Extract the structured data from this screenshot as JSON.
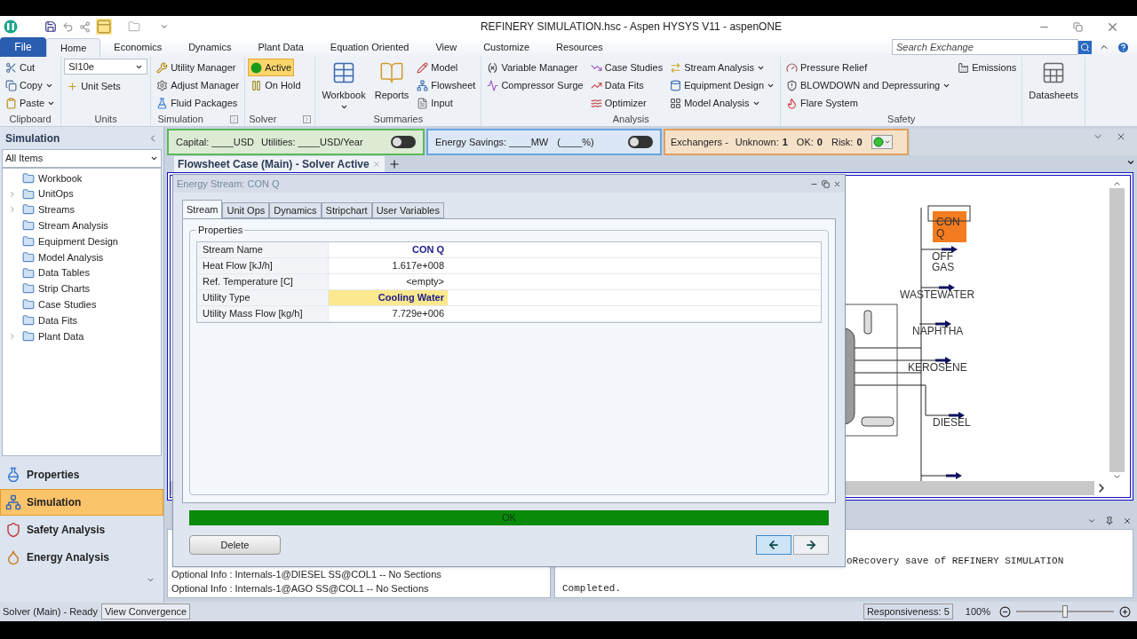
{
  "window": {
    "title": "REFINERY SIMULATION.hsc - Aspen HYSYS V11 - aspenONE"
  },
  "ribbon_tabs": [
    {
      "label": "File",
      "kind": "file",
      "selected": false
    },
    {
      "label": "Home",
      "kind": "tab",
      "selected": true
    },
    {
      "label": "Economics",
      "kind": "tab",
      "selected": false
    },
    {
      "label": "Dynamics",
      "kind": "tab",
      "selected": false
    },
    {
      "label": "Plant Data",
      "kind": "tab",
      "selected": false
    },
    {
      "label": "Equation Oriented",
      "kind": "tab",
      "selected": false
    },
    {
      "label": "View",
      "kind": "tab",
      "selected": false
    },
    {
      "label": "Customize",
      "kind": "tab",
      "selected": false
    },
    {
      "label": "Resources",
      "kind": "tab",
      "selected": false
    }
  ],
  "search": {
    "placeholder": "Search Exchange"
  },
  "ribbon_groups": [
    {
      "label": "Clipboard",
      "launcher": false,
      "columns": [
        [
          {
            "kind": "small",
            "label": "Cut",
            "menu": false
          },
          {
            "kind": "small",
            "label": "Copy",
            "menu": true
          },
          {
            "kind": "small",
            "label": "Paste",
            "menu": true
          }
        ]
      ]
    },
    {
      "label": "Units",
      "launcher": false,
      "columns": [
        [
          {
            "kind": "select",
            "label": "SI10e",
            "menu": true
          },
          {
            "kind": "small",
            "label": "Unit Sets",
            "menu": false
          }
        ]
      ]
    },
    {
      "label": "Simulation",
      "launcher": true,
      "columns": [
        [
          {
            "kind": "small",
            "label": "Utility Manager",
            "menu": false
          },
          {
            "kind": "small",
            "label": "Adjust Manager",
            "menu": false
          },
          {
            "kind": "small",
            "label": "Fluid Packages",
            "menu": false
          }
        ]
      ]
    },
    {
      "label": "Solver",
      "launcher": true,
      "columns": [
        [
          {
            "kind": "toggle",
            "label": "Active",
            "selected": true
          },
          {
            "kind": "toggle",
            "label": "On Hold",
            "selected": false
          }
        ]
      ]
    },
    {
      "label": "Summaries",
      "launcher": false,
      "columns": [
        [
          {
            "kind": "large",
            "label": "Workbook",
            "menu": true
          }
        ],
        [
          {
            "kind": "large",
            "label": "Reports",
            "menu": false
          }
        ],
        [
          {
            "kind": "small",
            "label": "Model",
            "menu": false
          },
          {
            "kind": "small",
            "label": "Flowsheet",
            "menu": false
          },
          {
            "kind": "small",
            "label": "Input",
            "menu": false
          }
        ]
      ]
    },
    {
      "label": "Analysis",
      "launcher": false,
      "columns": [
        [
          {
            "kind": "small",
            "label": "Variable Manager",
            "menu": false
          },
          {
            "kind": "small",
            "label": "Compressor Surge",
            "menu": false
          }
        ],
        [
          {
            "kind": "small",
            "label": "Case Studies",
            "menu": false
          },
          {
            "kind": "small",
            "label": "Data Fits",
            "menu": false
          },
          {
            "kind": "small",
            "label": "Optimizer",
            "menu": false
          }
        ],
        [
          {
            "kind": "small",
            "label": "Stream Analysis",
            "menu": true
          },
          {
            "kind": "small",
            "label": "Equipment Design",
            "menu": true
          },
          {
            "kind": "small",
            "label": "Model Analysis",
            "menu": true
          }
        ]
      ]
    },
    {
      "label": "Safety",
      "launcher": false,
      "columns": [
        [
          {
            "kind": "small",
            "label": "Pressure Relief",
            "menu": false
          },
          {
            "kind": "small",
            "label": "BLOWDOWN and Depressuring",
            "menu": true
          },
          {
            "kind": "small",
            "label": "Flare System",
            "menu": false
          }
        ],
        [
          {
            "kind": "small",
            "label": "Emissions",
            "menu": false
          }
        ]
      ]
    },
    {
      "columns": [
        [
          {
            "kind": "large",
            "label": "Datasheets",
            "menu": false
          }
        ]
      ]
    }
  ],
  "sidebar": {
    "title": "Simulation",
    "filter": "All Items",
    "items": [
      {
        "label": "Workbook",
        "expandable": false
      },
      {
        "label": "UnitOps",
        "expandable": true
      },
      {
        "label": "Streams",
        "expandable": true
      },
      {
        "label": "Stream Analysis",
        "expandable": false
      },
      {
        "label": "Equipment Design",
        "expandable": false
      },
      {
        "label": "Model Analysis",
        "expandable": false
      },
      {
        "label": "Data Tables",
        "expandable": false
      },
      {
        "label": "Strip Charts",
        "expandable": false
      },
      {
        "label": "Case Studies",
        "expandable": false
      },
      {
        "label": "Data Fits",
        "expandable": false
      },
      {
        "label": "Plant Data",
        "expandable": true
      }
    ],
    "nav": [
      {
        "label": "Properties",
        "selected": false
      },
      {
        "label": "Simulation",
        "selected": true
      },
      {
        "label": "Safety Analysis",
        "selected": false
      },
      {
        "label": "Energy Analysis",
        "selected": false
      }
    ]
  },
  "energy_bar": {
    "capital": {
      "capital": "Capital: ____USD",
      "utilities": "Utilities: ____USD/Year",
      "on": false
    },
    "savings": {
      "text": "Energy Savings: ____MW",
      "percent": "(____%)",
      "on": false
    },
    "exchangers": {
      "label": "Exchangers -",
      "counts": [
        {
          "label": "Unknown:",
          "value": "1"
        },
        {
          "label": "OK:",
          "value": "0"
        },
        {
          "label": "Risk:",
          "value": "0"
        }
      ]
    }
  },
  "doc_tabs": [
    {
      "label": "Flowsheet Case (Main) - Solver Active",
      "selected": true
    }
  ],
  "flowsheet": {
    "streams": [
      {
        "kind": "energy",
        "label": "CON Q"
      },
      {
        "kind": "material",
        "label": "OFF GAS"
      },
      {
        "kind": "material",
        "label": "WASTEWATER"
      },
      {
        "kind": "material",
        "label": "NAPHTHA"
      },
      {
        "kind": "material",
        "label": "KEROSENE"
      },
      {
        "kind": "material",
        "label": "DIESEL"
      }
    ]
  },
  "dialog": {
    "title": "Energy Stream: CON Q",
    "tabs": [
      {
        "label": "Stream",
        "selected": true
      },
      {
        "label": "Unit Ops",
        "selected": false
      },
      {
        "label": "Dynamics",
        "selected": false
      },
      {
        "label": "Stripchart",
        "selected": false
      },
      {
        "label": "User Variables",
        "selected": false
      }
    ],
    "group": "Properties",
    "rows": [
      {
        "label": "Stream Name",
        "value": "CON Q",
        "kind": "name"
      },
      {
        "label": "Heat Flow [kJ/h]",
        "value": "1.617e+008",
        "kind": "number"
      },
      {
        "label": "Ref. Temperature [C]",
        "value": "<empty>",
        "kind": "number"
      },
      {
        "label": "Utility Type",
        "value": "Cooling Water",
        "kind": "selection"
      },
      {
        "label": "Utility Mass Flow [kg/h]",
        "value": "7.729e+006",
        "kind": "number"
      }
    ],
    "status": "OK",
    "delete": "Delete"
  },
  "messages": {
    "left": [
      "Optional Info : Internals-1@DIESEL SS@COL1 -- No Sections",
      "Optional Info : Internals-1@AGO SS@COL1 -- No Sections"
    ],
    "right": [
      "oRecovery save of REFINERY SIMULATION",
      "Completed."
    ]
  },
  "status_bar": {
    "state": "Solver (Main) - Ready",
    "convergence": "View Convergence",
    "responsiveness": "Responsiveness: 5",
    "zoom": "100%",
    "zoom_slider": {
      "level": 0.5
    }
  }
}
